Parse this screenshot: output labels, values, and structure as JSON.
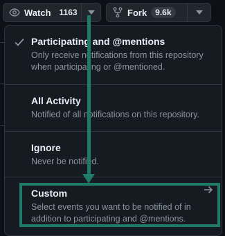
{
  "toolbar": {
    "watch": {
      "label": "Watch",
      "count": "1163",
      "icon": "eye-icon",
      "caret_icon": "triangle-down-icon"
    },
    "fork": {
      "label": "Fork",
      "count": "9.6k",
      "icon": "repo-forked-icon",
      "caret_icon": "triangle-down-icon"
    }
  },
  "dropdown": {
    "items": [
      {
        "title": "Participating and @mentions",
        "description": "Only receive notifications from this repository when participating or @mentioned.",
        "selected": true,
        "icon": "check-icon"
      },
      {
        "title": "All Activity",
        "description": "Notified of all notifications on this repository.",
        "selected": false
      },
      {
        "title": "Ignore",
        "description": "Never be notified.",
        "selected": false
      },
      {
        "title": "Custom",
        "description": "Select events you want to be notified of in addition to participating and @mentions.",
        "selected": false,
        "icon": "arrow-right-icon"
      }
    ]
  },
  "colors": {
    "background": "#0d1117",
    "panel": "#161b22",
    "border": "#30363d",
    "text": "#e6edf3",
    "muted": "#8b949e",
    "annotation": "#1f7a6a"
  }
}
